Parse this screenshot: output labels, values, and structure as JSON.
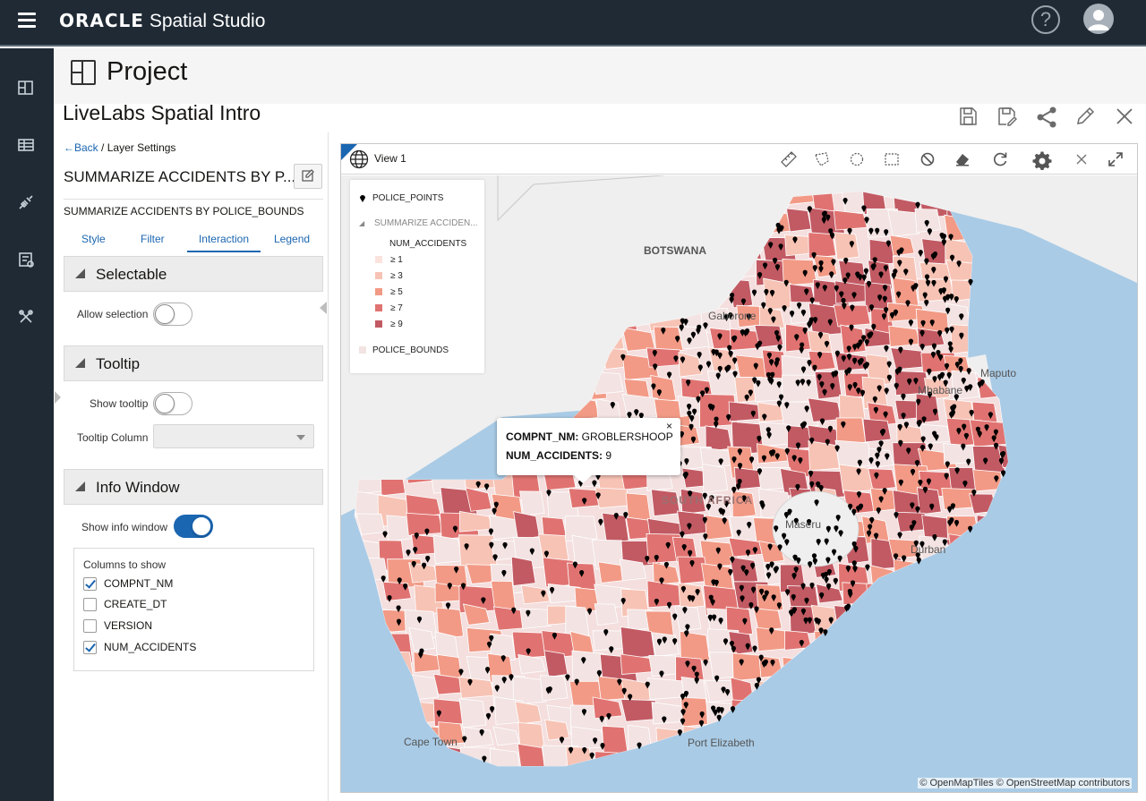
{
  "app": {
    "brand_oracle": "ORACLE",
    "brand_product": "Spatial Studio",
    "help_label": "?"
  },
  "page": {
    "title": "Project",
    "project_name": "LiveLabs Spatial Intro"
  },
  "panel": {
    "back_label": "Back",
    "crumb_separator": "/",
    "crumb_current": "Layer Settings",
    "layer_title": "SUMMARIZE ACCIDENTS BY P...",
    "layer_full_name": "SUMMARIZE ACCIDENTS BY POLICE_BOUNDS",
    "tabs": [
      {
        "label": "Style"
      },
      {
        "label": "Filter"
      },
      {
        "label": "Interaction"
      },
      {
        "label": "Legend"
      }
    ],
    "selectable": {
      "title": "Selectable",
      "allow_selection_label": "Allow selection",
      "allow_selection": false
    },
    "tooltip": {
      "title": "Tooltip",
      "show_tooltip_label": "Show tooltip",
      "show_tooltip": false,
      "column_label": "Tooltip Column",
      "column_value": ""
    },
    "info_window": {
      "title": "Info Window",
      "show_info_label": "Show info window",
      "show_info": true,
      "columns_title": "Columns to show",
      "columns": [
        {
          "label": "COMPNT_NM",
          "checked": true
        },
        {
          "label": "CREATE_DT",
          "checked": false
        },
        {
          "label": "VERSION",
          "checked": false
        },
        {
          "label": "NUM_ACCIDENTS",
          "checked": true
        }
      ]
    }
  },
  "view": {
    "title": "View 1",
    "legend": {
      "layer1": "POLICE_POINTS",
      "layer2": "SUMMARIZE ACCIDEN...",
      "attribute": "NUM_ACCIDENTS",
      "classes": [
        {
          "label": "≥ 1",
          "color": "#fbe3dd"
        },
        {
          "label": "≥ 3",
          "color": "#f7c3b5"
        },
        {
          "label": "≥ 5",
          "color": "#f29a86"
        },
        {
          "label": "≥ 7",
          "color": "#e07371"
        },
        {
          "label": "≥ 9",
          "color": "#c25a63"
        }
      ],
      "layer3": "POLICE_BOUNDS",
      "layer3_color": "#f3e3e3"
    },
    "tooltip": {
      "field1_name": "COMPNT_NM:",
      "field1_value": "GROBLERSHOOP",
      "field2_name": "NUM_ACCIDENTS:",
      "field2_value": "9",
      "close": "×"
    },
    "map_labels": {
      "botswana": "BOTSWANA",
      "gaborone": "Gaborone",
      "maputo": "Maputo",
      "mbabane": "Mbabane",
      "maseru": "Maseru",
      "durban": "Durban",
      "cape_town": "Cape Town",
      "port_elizabeth": "Port Elizabeth",
      "south_africa": "SOUTH AFRICA"
    },
    "attribution": "© OpenMapTiles  © OpenStreetMap contributors"
  },
  "colors": {
    "topbar": "#1f2a35",
    "accent": "#1b66b1",
    "water": "#a9cbe6",
    "land": "#efefef"
  }
}
